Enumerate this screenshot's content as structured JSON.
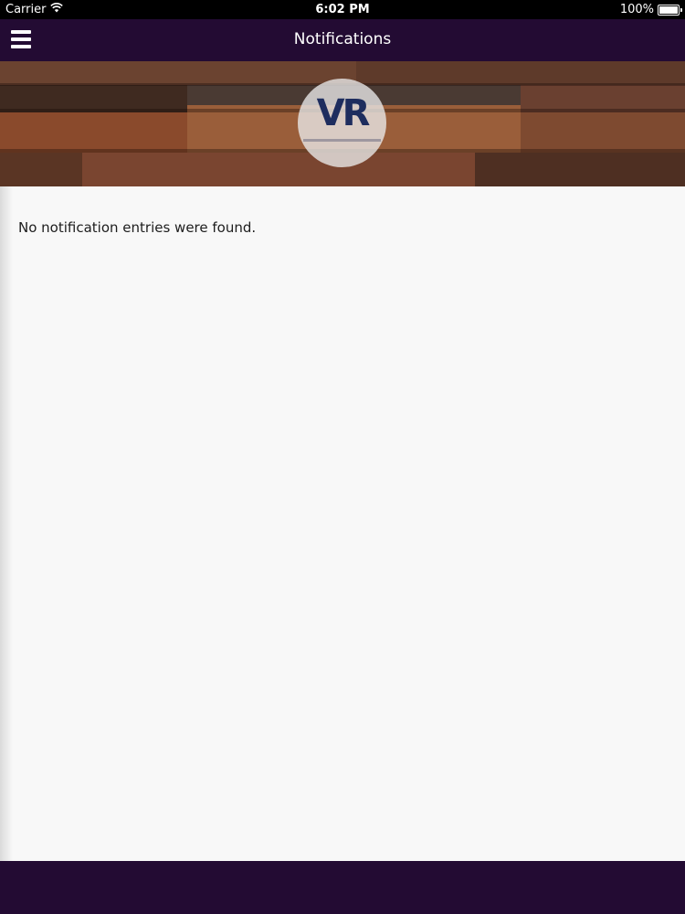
{
  "status_bar": {
    "carrier": "Carrier",
    "time": "6:02 PM",
    "battery": "100%",
    "wifi_icon": "wifi-icon",
    "battery_icon": "battery-icon"
  },
  "nav": {
    "title": "Notifications",
    "menu_icon": "hamburger-menu-icon",
    "background": "#230b33"
  },
  "banner": {
    "logo_text": "VR"
  },
  "content": {
    "empty_message": "No notification entries were found."
  },
  "colors": {
    "brand": "#230b33",
    "content_bg": "#f8f8f8"
  }
}
